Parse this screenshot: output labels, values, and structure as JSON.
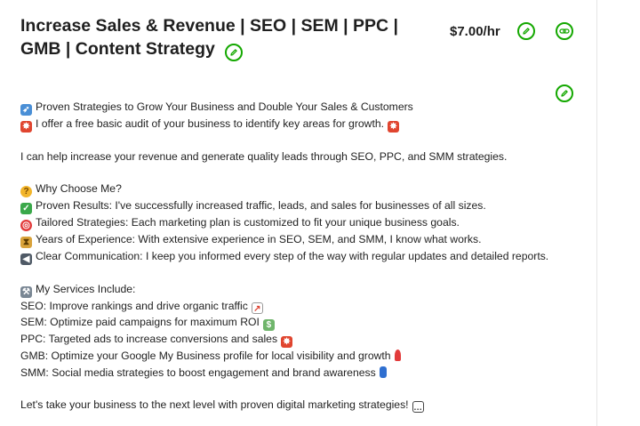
{
  "header": {
    "title": "Increase Sales & Revenue | SEO | SEM | PPC | GMB | Content Strategy",
    "rate": "$7.00/hr"
  },
  "icons": {
    "title_edit": "pencil-edit-icon",
    "rate_edit": "pencil-edit-icon",
    "link": "link-icon",
    "description_edit": "pencil-edit-icon",
    "accent_color": "#14a800"
  },
  "description": {
    "headline1": "Proven Strategies to Grow Your Business and Double Your Sales & Customers",
    "headline2": "I offer a free basic audit of your business to identify key areas for growth.",
    "intro": "I can help increase your revenue and generate quality leads through SEO, PPC, and SMM strategies.",
    "why_heading": "Why Choose Me?",
    "why_items": [
      "Proven Results: I've successfully increased traffic, leads, and sales for businesses of all sizes.",
      "Tailored Strategies: Each marketing plan is customized to fit your unique business goals.",
      "Years of Experience: With extensive experience in SEO, SEM, and SMM, I know what works.",
      "Clear Communication: I keep you informed every step of the way with regular updates and detailed reports."
    ],
    "services_heading": "My Services Include:",
    "services": [
      "SEO: Improve rankings and drive organic traffic",
      "SEM: Optimize paid campaigns for maximum ROI",
      "PPC: Targeted ads to increase conversions and sales",
      "GMB: Optimize your Google My Business profile for local visibility and growth",
      "SMM: Social media strategies to boost engagement and brand awareness"
    ],
    "closing": "Let's take your business to the next level with proven digital marketing strategies!"
  }
}
